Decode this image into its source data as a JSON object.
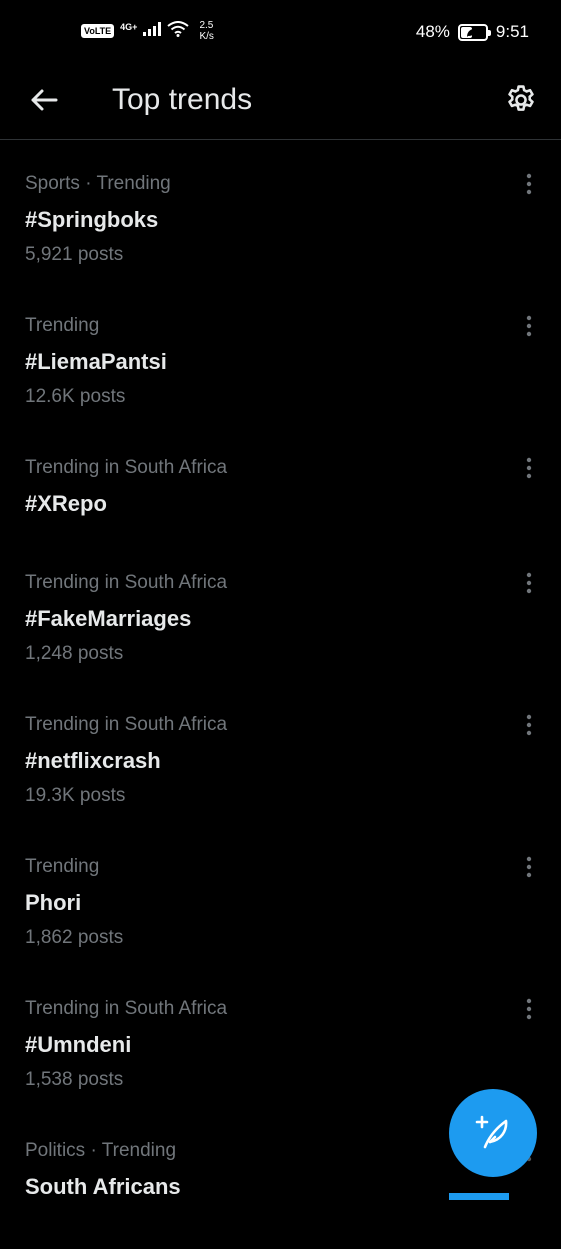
{
  "status_bar": {
    "volte": "VoLTE",
    "network": "4G+",
    "speed_value": "2.5",
    "speed_unit": "K/s",
    "battery": "48%",
    "battery_level": 0.48,
    "time": "9:51"
  },
  "header": {
    "title": "Top trends",
    "back_icon": "arrow-left-icon",
    "settings_icon": "gear-icon"
  },
  "trends": [
    {
      "context": "Sports · Trending",
      "name": "#Springboks",
      "count": "5,921 posts"
    },
    {
      "context": "Trending",
      "name": "#LiemaPantsi",
      "count": "12.6K posts"
    },
    {
      "context": "Trending in South Africa",
      "name": "#XRepo",
      "count": ""
    },
    {
      "context": "Trending in South Africa",
      "name": "#FakeMarriages",
      "count": "1,248 posts"
    },
    {
      "context": "Trending in South Africa",
      "name": "#netflixcrash",
      "count": "19.3K posts"
    },
    {
      "context": "Trending",
      "name": "Phori",
      "count": "1,862 posts"
    },
    {
      "context": "Trending in South Africa",
      "name": "#Umndeni",
      "count": "1,538 posts"
    },
    {
      "context": "Politics · Trending",
      "name": "South Africans",
      "count": ""
    }
  ],
  "fab": {
    "icon": "compose-feather-icon"
  },
  "colors": {
    "background": "#000000",
    "primary_text": "#e7e9ea",
    "secondary_text": "#71767b",
    "divider": "#2f3336",
    "accent": "#1d9bf0"
  }
}
